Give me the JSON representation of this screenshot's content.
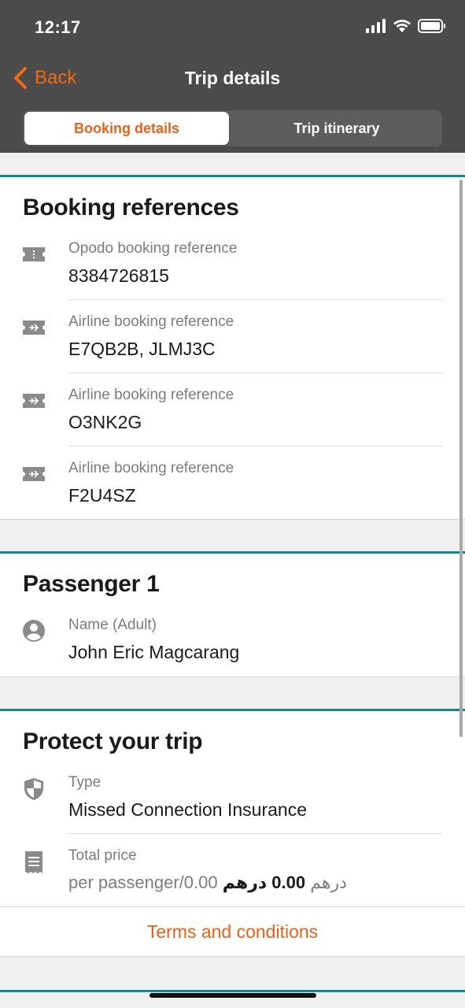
{
  "status": {
    "time": "12:17"
  },
  "nav": {
    "back_label": "Back",
    "title": "Trip details"
  },
  "tabs": {
    "active": "Booking details",
    "inactive": "Trip itinerary"
  },
  "booking": {
    "title": "Booking references",
    "items": [
      {
        "label": "Opodo booking reference",
        "value": "8384726815",
        "icon": "ticket-icon"
      },
      {
        "label": "Airline booking reference",
        "value": "E7QB2B, JLMJ3C",
        "icon": "airline-ticket-icon"
      },
      {
        "label": "Airline booking reference",
        "value": "O3NK2G",
        "icon": "airline-ticket-icon"
      },
      {
        "label": "Airline booking reference",
        "value": "F2U4SZ",
        "icon": "airline-ticket-icon"
      }
    ]
  },
  "passenger": {
    "title": "Passenger 1",
    "label": "Name (Adult)",
    "value": "John Eric Magcarang",
    "icon": "person-icon"
  },
  "protect": {
    "title": "Protect your trip",
    "type_label": "Type",
    "type_value": "Missed Connection Insurance",
    "price_label": "Total price",
    "price_total": "0.00 درهم",
    "price_per": "per passenger/0.00 درهم",
    "terms": "Terms and conditions"
  },
  "colors": {
    "accent": "#e8621a",
    "header": "#4b4b4b",
    "divider_teal": "#0e8a8a"
  }
}
